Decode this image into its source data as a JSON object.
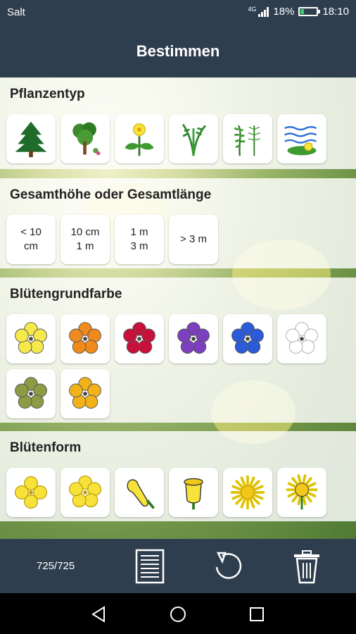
{
  "status_bar": {
    "carrier": "Salt",
    "network": "4G",
    "battery": "18%",
    "time": "18:10"
  },
  "header": {
    "title": "Bestimmen"
  },
  "sections": {
    "plant_type": {
      "title": "Pflanzentyp",
      "items": [
        "tree-icon",
        "shrub-icon",
        "herb-icon",
        "grass-icon",
        "fern-icon",
        "water-plant-icon"
      ]
    },
    "height": {
      "title": "Gesamthöhe oder Gesamtlänge",
      "options": [
        "< 10 cm",
        "10 cm – 1 m",
        "1 m – 3 m",
        "> 3 m"
      ],
      "labels": {
        "opt1_line1": "< 10",
        "opt1_line2": "cm",
        "opt2_line1": "10 cm",
        "opt2_line2": "1 m",
        "opt3_line1": "1 m",
        "opt3_line2": "3 m",
        "opt4": "> 3 m"
      }
    },
    "flower_color": {
      "title": "Blütengrundfarbe",
      "colors": [
        "#f6e94a",
        "#f08a1c",
        "#c8103a",
        "#7b3fbf",
        "#2a5bd8",
        "#ffffff",
        "#8e9a44",
        "#f2b21a"
      ]
    },
    "flower_shape": {
      "title": "Blütenform",
      "items": [
        "radial-4-icon",
        "radial-5-icon",
        "lipped-icon",
        "bell-icon",
        "ray-flower-icon",
        "composite-icon"
      ]
    }
  },
  "bottom_bar": {
    "count": "725/725",
    "list_icon": "list-icon",
    "reset_icon": "undo-icon",
    "delete_icon": "trash-icon"
  },
  "nav_bar": {
    "back_icon": "back-triangle-icon",
    "home_icon": "home-circle-icon",
    "recents_icon": "recents-square-icon"
  }
}
